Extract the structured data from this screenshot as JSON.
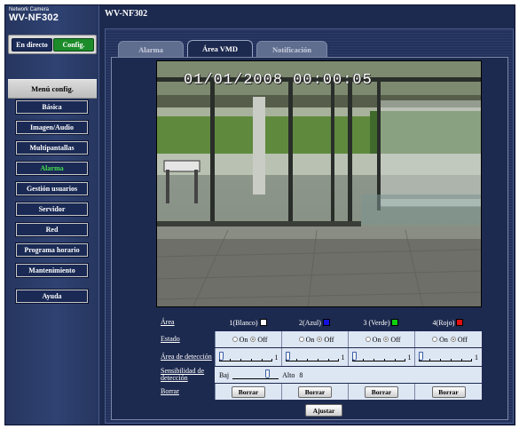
{
  "app": {
    "brand": "Network Camera",
    "model": "WV-NF302",
    "header_title": "WV-NF302"
  },
  "mode": {
    "live_label": "En directo",
    "config_label": "Config."
  },
  "menu": {
    "title": "Menú config.",
    "items": [
      {
        "label": "Básica",
        "active": false
      },
      {
        "label": "Imagen/Audio",
        "active": false
      },
      {
        "label": "Multipantallas",
        "active": false
      },
      {
        "label": "Alarma",
        "active": true
      },
      {
        "label": "Gestión usuarios",
        "active": false
      },
      {
        "label": "Servidor",
        "active": false
      },
      {
        "label": "Red",
        "active": false
      },
      {
        "label": "Programa horario",
        "active": false
      },
      {
        "label": "Mantenimiento",
        "active": false
      },
      {
        "label": "Ayuda",
        "active": false
      }
    ]
  },
  "tabs": [
    {
      "label": "Alarma",
      "active": false
    },
    {
      "label": "Área VMD",
      "active": true
    },
    {
      "label": "Notificación",
      "active": false
    }
  ],
  "video": {
    "timestamp": "01/01/2008 00:00:05"
  },
  "settings": {
    "labels": {
      "area": "Área",
      "estado": "Estado",
      "area_deteccion": "Área de detección",
      "sensibilidad": "Sensibilidad de detección",
      "borrar": "Borrar"
    },
    "areas": [
      {
        "name": "1(Blanco)",
        "color": "#ffffff",
        "state": "Off",
        "detection_value": "1"
      },
      {
        "name": "2(Azul)",
        "color": "#1010e0",
        "state": "Off",
        "detection_value": "1"
      },
      {
        "name": "3 (Verde)",
        "color": "#10d010",
        "state": "Off",
        "detection_value": "1"
      },
      {
        "name": "4(Rojo)",
        "color": "#e01010",
        "state": "Off",
        "detection_value": "1"
      }
    ],
    "radio_on": "On",
    "radio_off": "Off",
    "sensitivity": {
      "low_label": "Baj",
      "high_label": "Alto",
      "value": "8",
      "level": 8,
      "max": 10
    },
    "borrar_button": "Borrar",
    "ajustar_button": "Ajustar"
  },
  "colors": {
    "frame_bg": "#1d2a4f",
    "config_green": "#1c8c2a",
    "active_menu_text": "#46e04b"
  }
}
